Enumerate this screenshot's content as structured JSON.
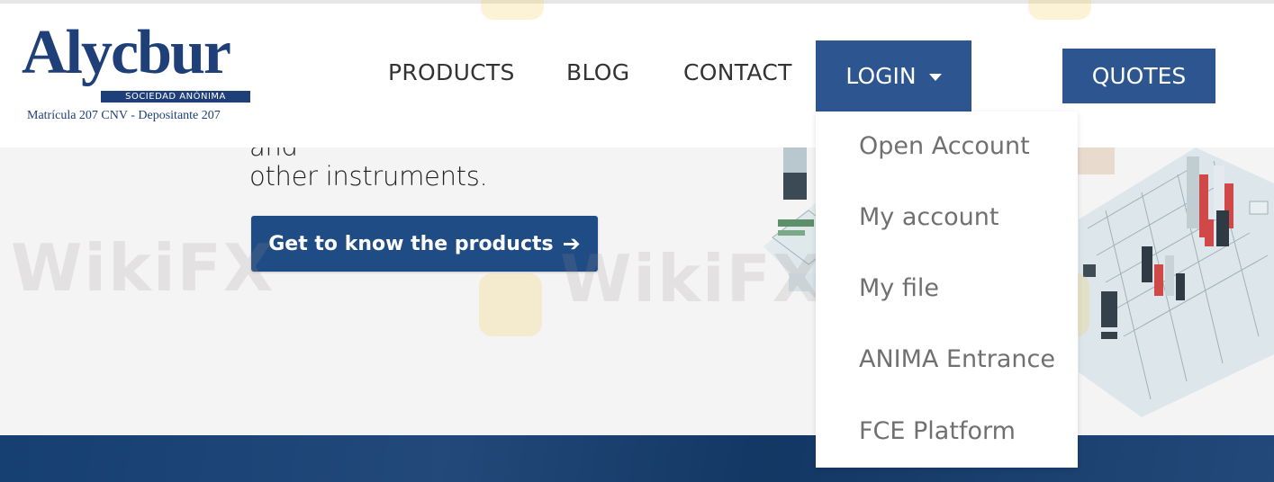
{
  "brand": {
    "name": "Alycbur",
    "tagline": "SOCIEDAD ANÓNIMA",
    "registration": "Matrícula 207 CNV - Depositante 207"
  },
  "nav": {
    "products": "PRODUCTS",
    "blog": "BLOG",
    "contact": "CONTACT",
    "login": "LOGIN",
    "quotes": "QUOTES"
  },
  "login_menu": {
    "items": [
      "Open Account",
      "My account",
      "My file",
      "ANIMA Entrance",
      "FCE Platform"
    ]
  },
  "hero": {
    "line1": "and",
    "line2": "other instruments.",
    "cta_label": "Get to know the products",
    "cta_arrow": "➔"
  },
  "watermark": {
    "text": "WikiFX"
  },
  "icons": {
    "caret": "caret-down-icon",
    "arrow": "arrow-right-icon"
  },
  "colors": {
    "brand_blue": "#1f3f78",
    "button_blue": "#2d5690",
    "cta_blue": "#1f4c85",
    "footer_blue": "#163f72",
    "menu_text": "#707070"
  }
}
